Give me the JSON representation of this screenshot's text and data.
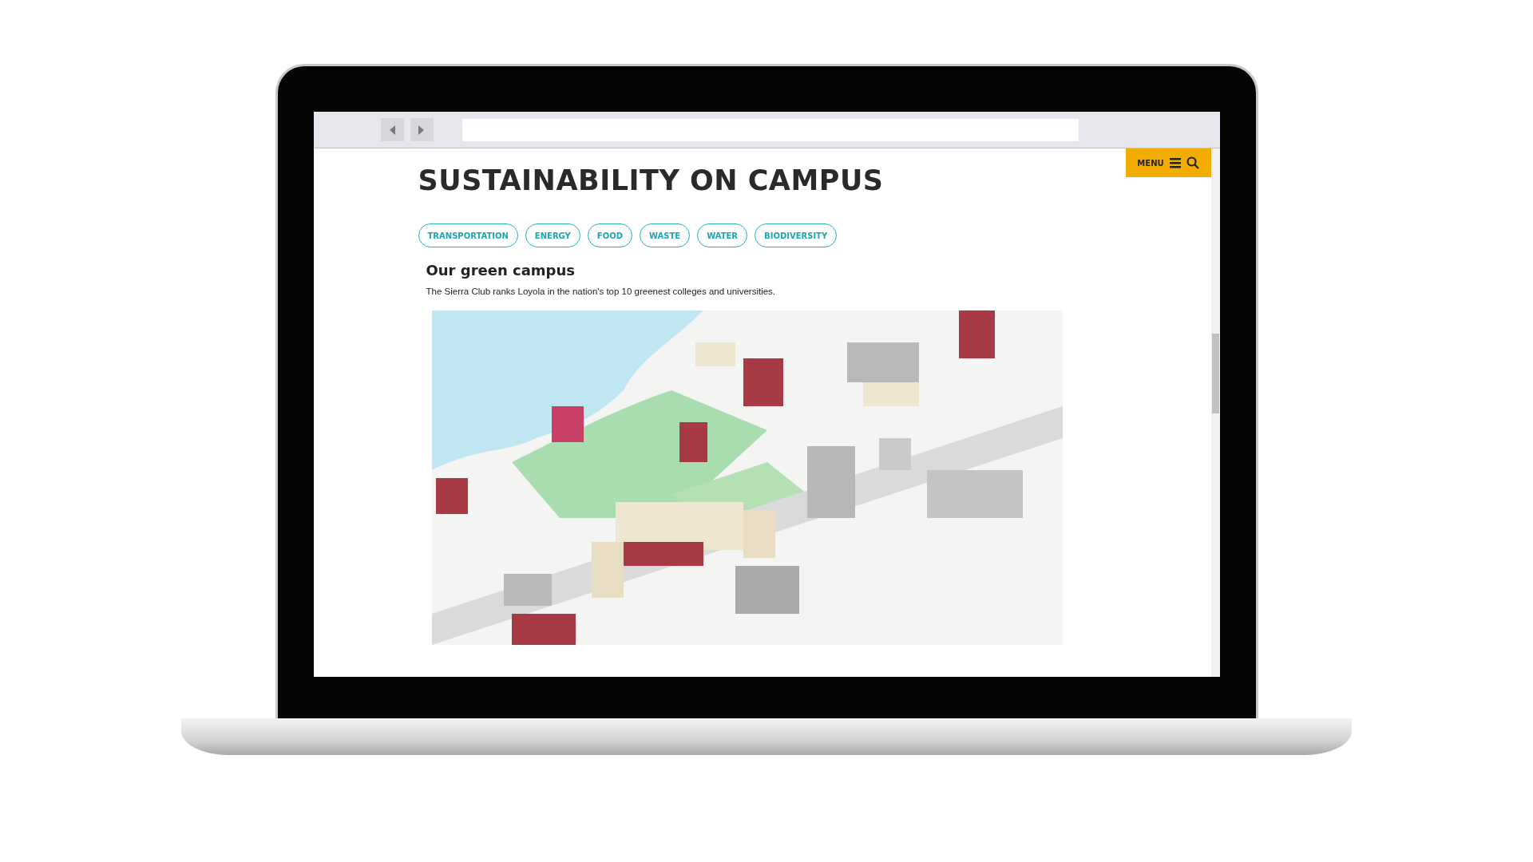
{
  "page": {
    "title": "SUSTAINABILITY ON CAMPUS",
    "menu": {
      "label": "MENU"
    },
    "tags": [
      {
        "label": "TRANSPORTATION"
      },
      {
        "label": "ENERGY"
      },
      {
        "label": "FOOD"
      },
      {
        "label": "WASTE"
      },
      {
        "label": "WATER"
      },
      {
        "label": "BIODIVERSITY"
      }
    ],
    "section": {
      "heading": "Our green campus",
      "text": "The Sierra Club ranks Loyola in the nation's top 10 greenest colleges and universities."
    }
  }
}
